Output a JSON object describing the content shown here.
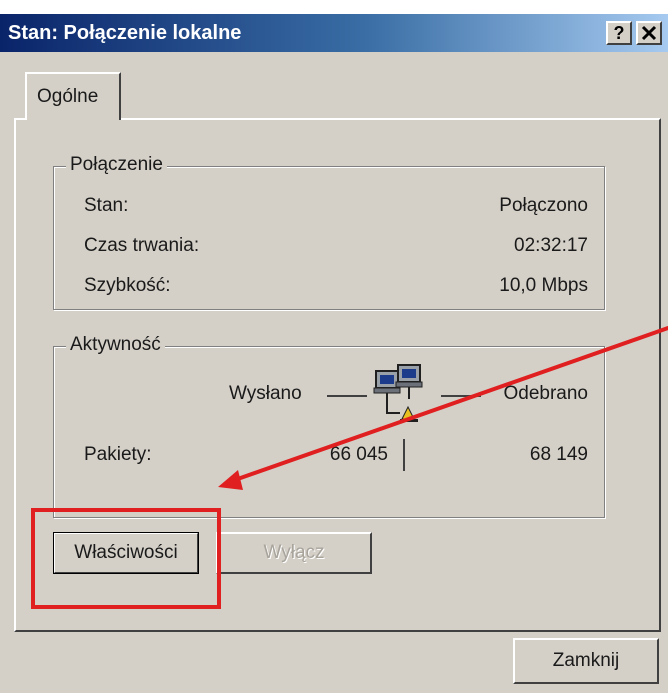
{
  "window": {
    "title": "Stan: Połączenie lokalne",
    "help_label": "?",
    "close_label": "✕"
  },
  "tabs": [
    {
      "label": "Ogólne",
      "selected": true
    }
  ],
  "connection": {
    "legend": "Połączenie",
    "rows": [
      {
        "label": "Stan:",
        "value": "Połączono"
      },
      {
        "label": "Czas trwania:",
        "value": "02:32:17"
      },
      {
        "label": "Szybkość:",
        "value": "10,0 Mbps"
      }
    ]
  },
  "activity": {
    "legend": "Aktywność",
    "sent_label": "Wysłano",
    "received_label": "Odebrano",
    "packets_label": "Pakiety:",
    "packets_sent": "66 045",
    "packets_received": "68 149"
  },
  "buttons": {
    "properties": "Właściwości",
    "disable": "Wyłącz",
    "close": "Zamknij"
  },
  "annotation": {
    "color": "#e02020"
  },
  "icons": {
    "network": "network-computers-icon"
  }
}
